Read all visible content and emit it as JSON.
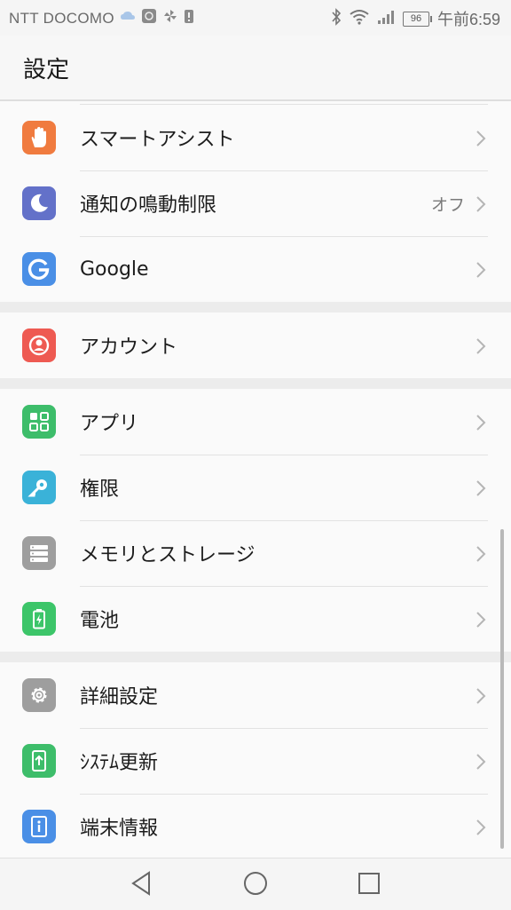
{
  "status_bar": {
    "carrier": "NTT DOCOMO",
    "battery": "96",
    "time": "午前6:59",
    "icons": [
      "cloud-sync-icon",
      "sim-icon",
      "pinwheel-icon",
      "alert-icon",
      "bluetooth-icon",
      "wifi-icon",
      "signal-icon",
      "battery-icon"
    ]
  },
  "header": {
    "title": "設定"
  },
  "groups": [
    {
      "items": [
        {
          "label": "スマートアシスト",
          "icon": "hand-icon",
          "color": "#f07b3f"
        },
        {
          "label": "通知の鳴動制限",
          "value": "オフ",
          "icon": "moon-icon",
          "color": "#6371c9"
        },
        {
          "label": "Google",
          "icon": "google-icon",
          "color": "#4a8fe6"
        }
      ]
    },
    {
      "items": [
        {
          "label": "アカウント",
          "icon": "account-icon",
          "color": "#ee5a52"
        }
      ]
    },
    {
      "items": [
        {
          "label": "アプリ",
          "icon": "apps-icon",
          "color": "#3dbd6a"
        },
        {
          "label": "権限",
          "icon": "key-icon",
          "color": "#3ab2d8"
        },
        {
          "label": "メモリとストレージ",
          "icon": "storage-icon",
          "color": "#9e9e9e"
        },
        {
          "label": "電池",
          "icon": "battery-icon",
          "color": "#3cc569"
        }
      ]
    },
    {
      "items": [
        {
          "label": "詳細設定",
          "icon": "gear-icon",
          "color": "#9e9e9e"
        },
        {
          "label": "ｼｽﾃﾑ更新",
          "icon": "system-update-icon",
          "color": "#3dbd6a"
        },
        {
          "label": "端末情報",
          "icon": "info-icon",
          "color": "#4a8fe6"
        }
      ]
    }
  ],
  "nav": {
    "icons": [
      "back-icon",
      "home-icon",
      "recents-icon"
    ]
  }
}
